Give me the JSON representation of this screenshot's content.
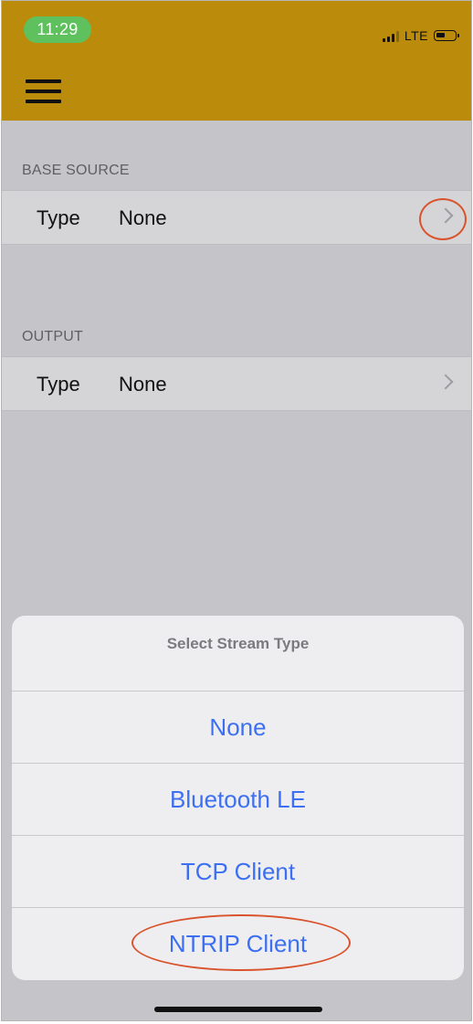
{
  "status_bar": {
    "time": "11:29",
    "network": "LTE",
    "icons": [
      "signal-icon",
      "battery-icon"
    ]
  },
  "header": {
    "menu_icon": "hamburger-menu-icon",
    "background": "#bb8b0b"
  },
  "sections": [
    {
      "header": "BASE SOURCE",
      "row": {
        "key": "Type",
        "value": "None"
      }
    },
    {
      "header": "OUTPUT",
      "row": {
        "key": "Type",
        "value": "None"
      }
    }
  ],
  "action_sheet": {
    "title": "Select Stream Type",
    "options": [
      "None",
      "Bluetooth LE",
      "TCP Client",
      "NTRIP Client"
    ]
  },
  "colors": {
    "accent": "#3d6ff2",
    "annotation": "#d9532c",
    "time_pill": "#5ec15e"
  }
}
